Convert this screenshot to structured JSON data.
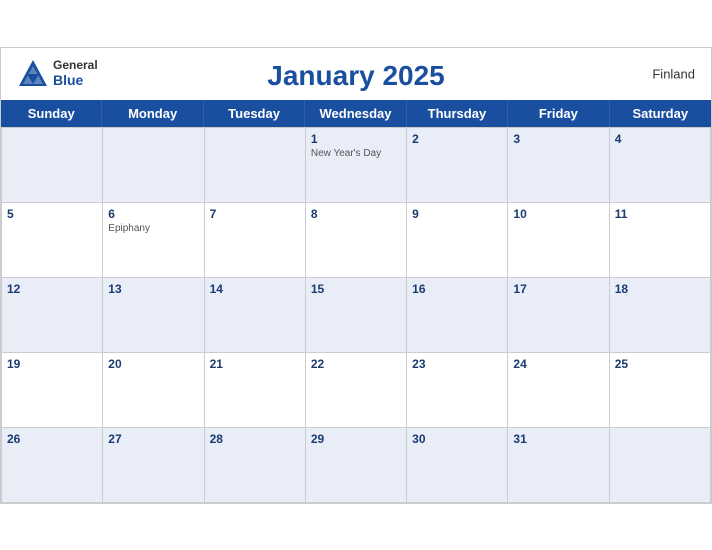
{
  "header": {
    "title": "January 2025",
    "country": "Finland",
    "logo_general": "General",
    "logo_blue": "Blue"
  },
  "days_of_week": [
    "Sunday",
    "Monday",
    "Tuesday",
    "Wednesday",
    "Thursday",
    "Friday",
    "Saturday"
  ],
  "weeks": [
    [
      {
        "date": "",
        "holiday": ""
      },
      {
        "date": "",
        "holiday": ""
      },
      {
        "date": "",
        "holiday": ""
      },
      {
        "date": "1",
        "holiday": "New Year's Day"
      },
      {
        "date": "2",
        "holiday": ""
      },
      {
        "date": "3",
        "holiday": ""
      },
      {
        "date": "4",
        "holiday": ""
      }
    ],
    [
      {
        "date": "5",
        "holiday": ""
      },
      {
        "date": "6",
        "holiday": "Epiphany"
      },
      {
        "date": "7",
        "holiday": ""
      },
      {
        "date": "8",
        "holiday": ""
      },
      {
        "date": "9",
        "holiday": ""
      },
      {
        "date": "10",
        "holiday": ""
      },
      {
        "date": "11",
        "holiday": ""
      }
    ],
    [
      {
        "date": "12",
        "holiday": ""
      },
      {
        "date": "13",
        "holiday": ""
      },
      {
        "date": "14",
        "holiday": ""
      },
      {
        "date": "15",
        "holiday": ""
      },
      {
        "date": "16",
        "holiday": ""
      },
      {
        "date": "17",
        "holiday": ""
      },
      {
        "date": "18",
        "holiday": ""
      }
    ],
    [
      {
        "date": "19",
        "holiday": ""
      },
      {
        "date": "20",
        "holiday": ""
      },
      {
        "date": "21",
        "holiday": ""
      },
      {
        "date": "22",
        "holiday": ""
      },
      {
        "date": "23",
        "holiday": ""
      },
      {
        "date": "24",
        "holiday": ""
      },
      {
        "date": "25",
        "holiday": ""
      }
    ],
    [
      {
        "date": "26",
        "holiday": ""
      },
      {
        "date": "27",
        "holiday": ""
      },
      {
        "date": "28",
        "holiday": ""
      },
      {
        "date": "29",
        "holiday": ""
      },
      {
        "date": "30",
        "holiday": ""
      },
      {
        "date": "31",
        "holiday": ""
      },
      {
        "date": "",
        "holiday": ""
      }
    ]
  ],
  "colors": {
    "header_blue": "#1a4fa0",
    "row_blue": "#e8edf8",
    "row_white": "#ffffff"
  }
}
